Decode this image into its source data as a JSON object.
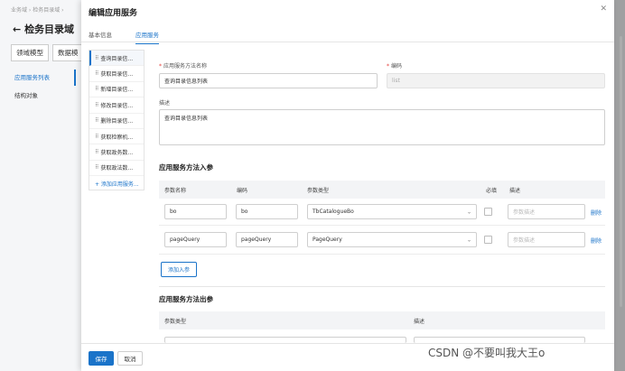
{
  "background": {
    "breadcrumb": "业务域 › 检务目录域 ›",
    "title": "检务目录域",
    "back_icon": "arrow-left-icon",
    "tabs": [
      "领域模型",
      "数据模"
    ],
    "nav": [
      "应用服务列表",
      "结构对象"
    ]
  },
  "drawer": {
    "title": "编辑应用服务",
    "close_icon": "close-icon",
    "tabs": [
      "基本信息",
      "应用服务"
    ],
    "active_tab": "应用服务"
  },
  "methods": {
    "items": [
      "查询目录信...",
      "获取目录信...",
      "新增目录信...",
      "修改目录信...",
      "删除目录信...",
      "获取检察机...",
      "获取政务数...",
      "获取政法数..."
    ],
    "add_label": "+ 添加应用服务..."
  },
  "form": {
    "name_label": "应用服务方法名称",
    "name_value": "查询目录信息列表",
    "code_label": "编码",
    "code_value": "list",
    "desc_label": "描述",
    "desc_value": "查询目录信息列表",
    "input_section": "应用服务方法入参",
    "input_headers": {
      "name": "参数名称",
      "code": "编码",
      "type": "参数类型",
      "required": "必填",
      "desc": "描述"
    },
    "input_rows": [
      {
        "name": "bo",
        "code": "bo",
        "type": "TbCatalogueBo",
        "desc_placeholder": "参数描述",
        "delete": "删除"
      },
      {
        "name": "pageQuery",
        "code": "pageQuery",
        "type": "PageQuery",
        "desc_placeholder": "参数描述",
        "delete": "删除"
      }
    ],
    "add_param": "添加入参",
    "output_section": "应用服务方法出参",
    "output_headers": {
      "type": "参数类型",
      "desc": "描述"
    }
  },
  "footer": {
    "save": "保存",
    "cancel": "取消"
  },
  "watermark": "CSDN @不要叫我大王o",
  "colors": {
    "primary": "#1a73c9",
    "required": "#e53935"
  }
}
